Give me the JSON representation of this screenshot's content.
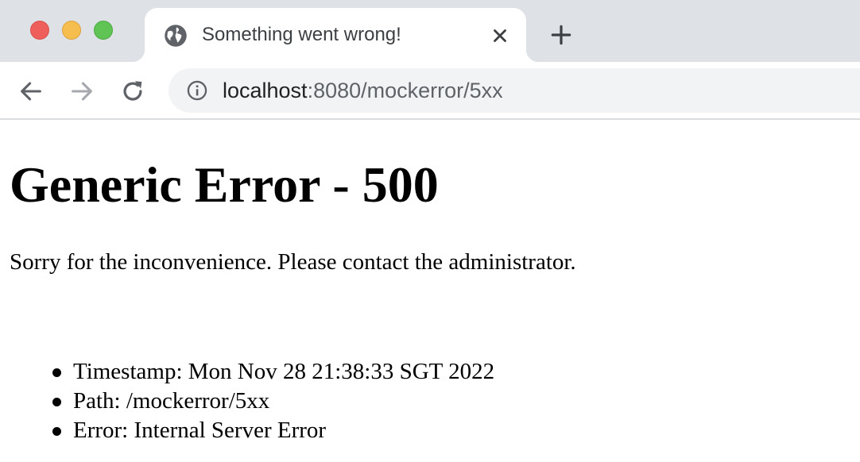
{
  "browser": {
    "tab": {
      "title": "Something went wrong!",
      "favicon": "globe-icon"
    },
    "new_tab_icon": "plus-icon",
    "toolbar": {
      "back_icon": "arrow-left-icon",
      "forward_icon": "arrow-right-icon",
      "reload_icon": "reload-icon",
      "site_info_icon": "info-icon",
      "url_host": "localhost",
      "url_rest": ":8080/mockerror/5xx"
    },
    "colors": {
      "tabstrip": "#dee1e6",
      "close_red": "#ee5f5b",
      "minimize_yellow": "#f6bd4f",
      "maximize_green": "#5fc454",
      "omnibox": "#f1f3f4"
    }
  },
  "page": {
    "heading": "Generic Error - 500",
    "message": "Sorry for the inconvenience. Please contact the administrator.",
    "details": [
      "Timestamp: Mon Nov 28 21:38:33 SGT 2022",
      "Path: /mockerror/5xx",
      "Error: Internal Server Error"
    ]
  }
}
